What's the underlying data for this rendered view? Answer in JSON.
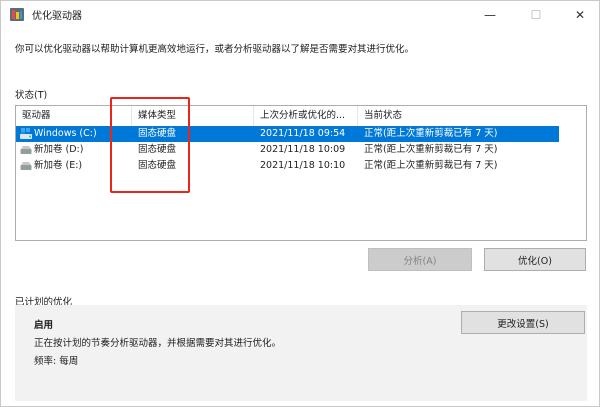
{
  "window": {
    "title": "优化驱动器",
    "min_glyph": "—",
    "max_glyph": "☐",
    "close_glyph": "✕"
  },
  "description": "你可以优化驱动器以帮助计算机更高效地运行，或者分析驱动器以了解是否需要对其进行优化。",
  "status_label": "状态(T)",
  "table": {
    "headers": [
      "驱动器",
      "媒体类型",
      "上次分析或优化的...",
      "当前状态"
    ],
    "rows": [
      {
        "drive": "Windows  (C:)",
        "media": "固态硬盘",
        "last": "2021/11/18 09:54",
        "status": "正常(距上次重新剪裁已有 7 天)",
        "icon": "windows-drive-icon",
        "selected": true
      },
      {
        "drive": "新加卷 (D:)",
        "media": "固态硬盘",
        "last": "2021/11/18 10:09",
        "status": "正常(距上次重新剪裁已有 7 天)",
        "icon": "drive-icon",
        "selected": false
      },
      {
        "drive": "新加卷 (E:)",
        "media": "固态硬盘",
        "last": "2021/11/18 10:10",
        "status": "正常(距上次重新剪裁已有 7 天)",
        "icon": "drive-icon",
        "selected": false
      }
    ]
  },
  "buttons": {
    "analyze": "分析(A)",
    "optimize": "优化(O)",
    "change_settings": "更改设置(S)"
  },
  "scheduled": {
    "label": "已计划的优化",
    "state": "启用",
    "description": "正在按计划的节奏分析驱动器，并根据需要对其进行优化。",
    "frequency": "频率: 每周"
  },
  "colors": {
    "selection": "#0078d7",
    "annotation_box": "#e8261c"
  }
}
